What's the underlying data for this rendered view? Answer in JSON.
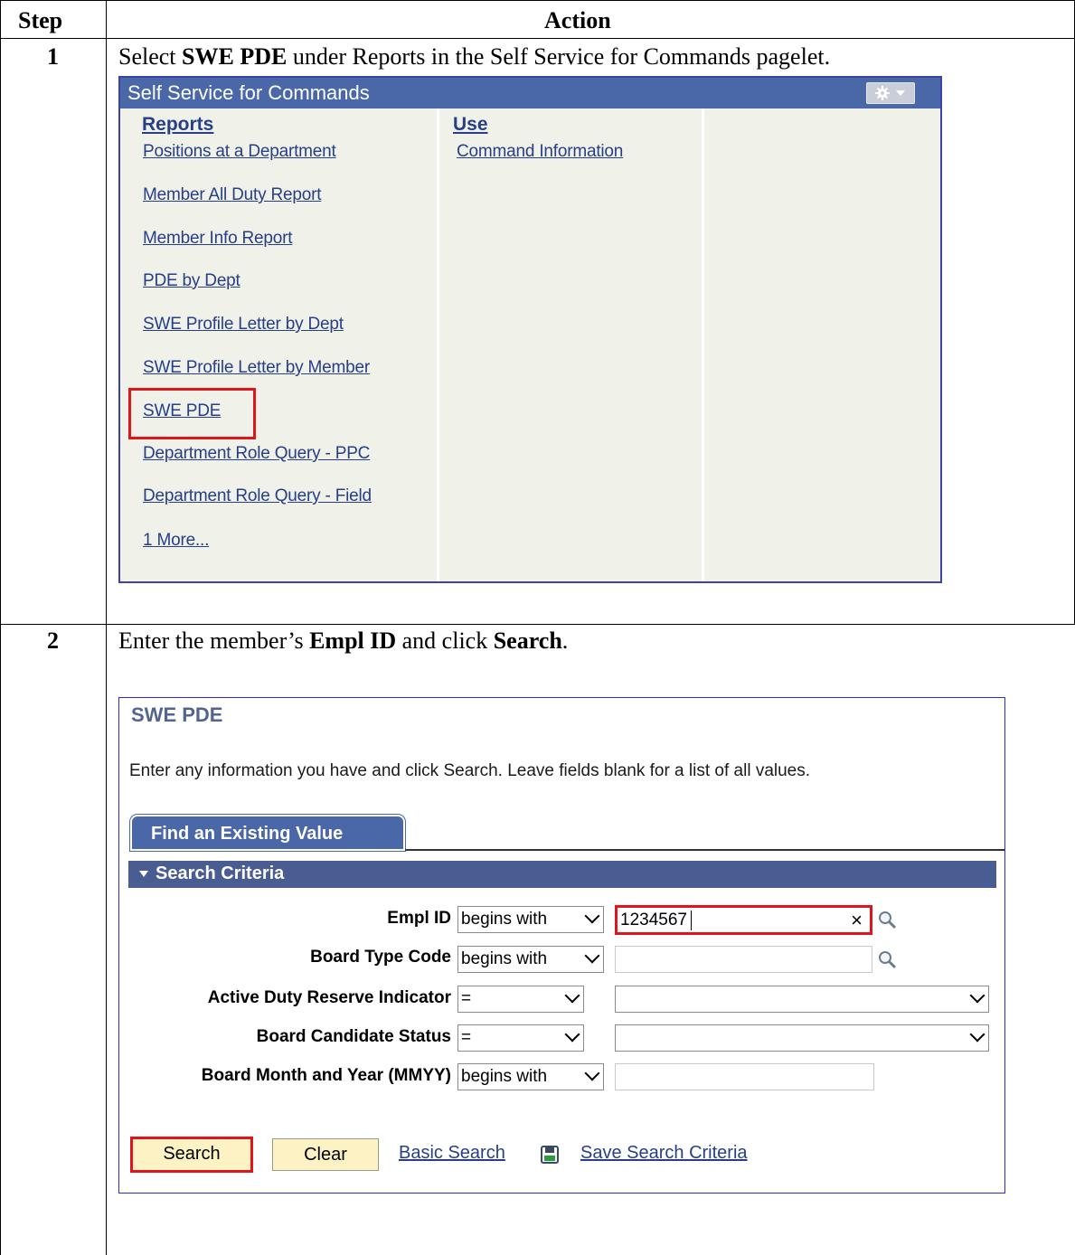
{
  "table": {
    "header_step": "Step",
    "header_action": "Action"
  },
  "step1": {
    "number": "1",
    "instruction_pre": "Select ",
    "instruction_bold": "SWE PDE",
    "instruction_post": " under Reports in the Self Service for Commands pagelet."
  },
  "pagelet": {
    "title": "Self Service for Commands",
    "reports_heading": "Reports",
    "use_heading": "Use",
    "reports_links": [
      "Positions at a Department",
      "Member All Duty Report",
      "Member Info Report",
      "PDE by Dept",
      "SWE Profile Letter by Dept",
      "SWE Profile Letter by Member",
      "SWE PDE",
      "Department Role Query - PPC",
      "Department Role Query - Field",
      "1 More..."
    ],
    "use_links": [
      "Command Information"
    ]
  },
  "step2": {
    "number": "2",
    "instruction_pre": "Enter the member’s ",
    "instruction_bold1": "Empl ID",
    "instruction_mid": " and click ",
    "instruction_bold2": "Search",
    "instruction_post": "."
  },
  "search_page": {
    "title": "SWE PDE",
    "description": "Enter any information you have and click Search. Leave fields blank for a list of all values.",
    "tab_label": "Find an Existing Value",
    "criteria_label": "Search Criteria",
    "fields": [
      {
        "label": "Empl ID",
        "operator": "begins with",
        "value": "1234567"
      },
      {
        "label": "Board Type Code",
        "operator": "begins with",
        "value": ""
      },
      {
        "label": "Active Duty Reserve Indicator",
        "operator": "=",
        "value": ""
      },
      {
        "label": "Board Candidate Status",
        "operator": "=",
        "value": ""
      },
      {
        "label": "Board Month and Year (MMYY)",
        "operator": "begins with",
        "value": ""
      }
    ],
    "clear_x": "×",
    "search_button": "Search",
    "clear_button": "Clear",
    "basic_search_link": "Basic Search",
    "save_criteria_link": "Save Search Criteria"
  }
}
